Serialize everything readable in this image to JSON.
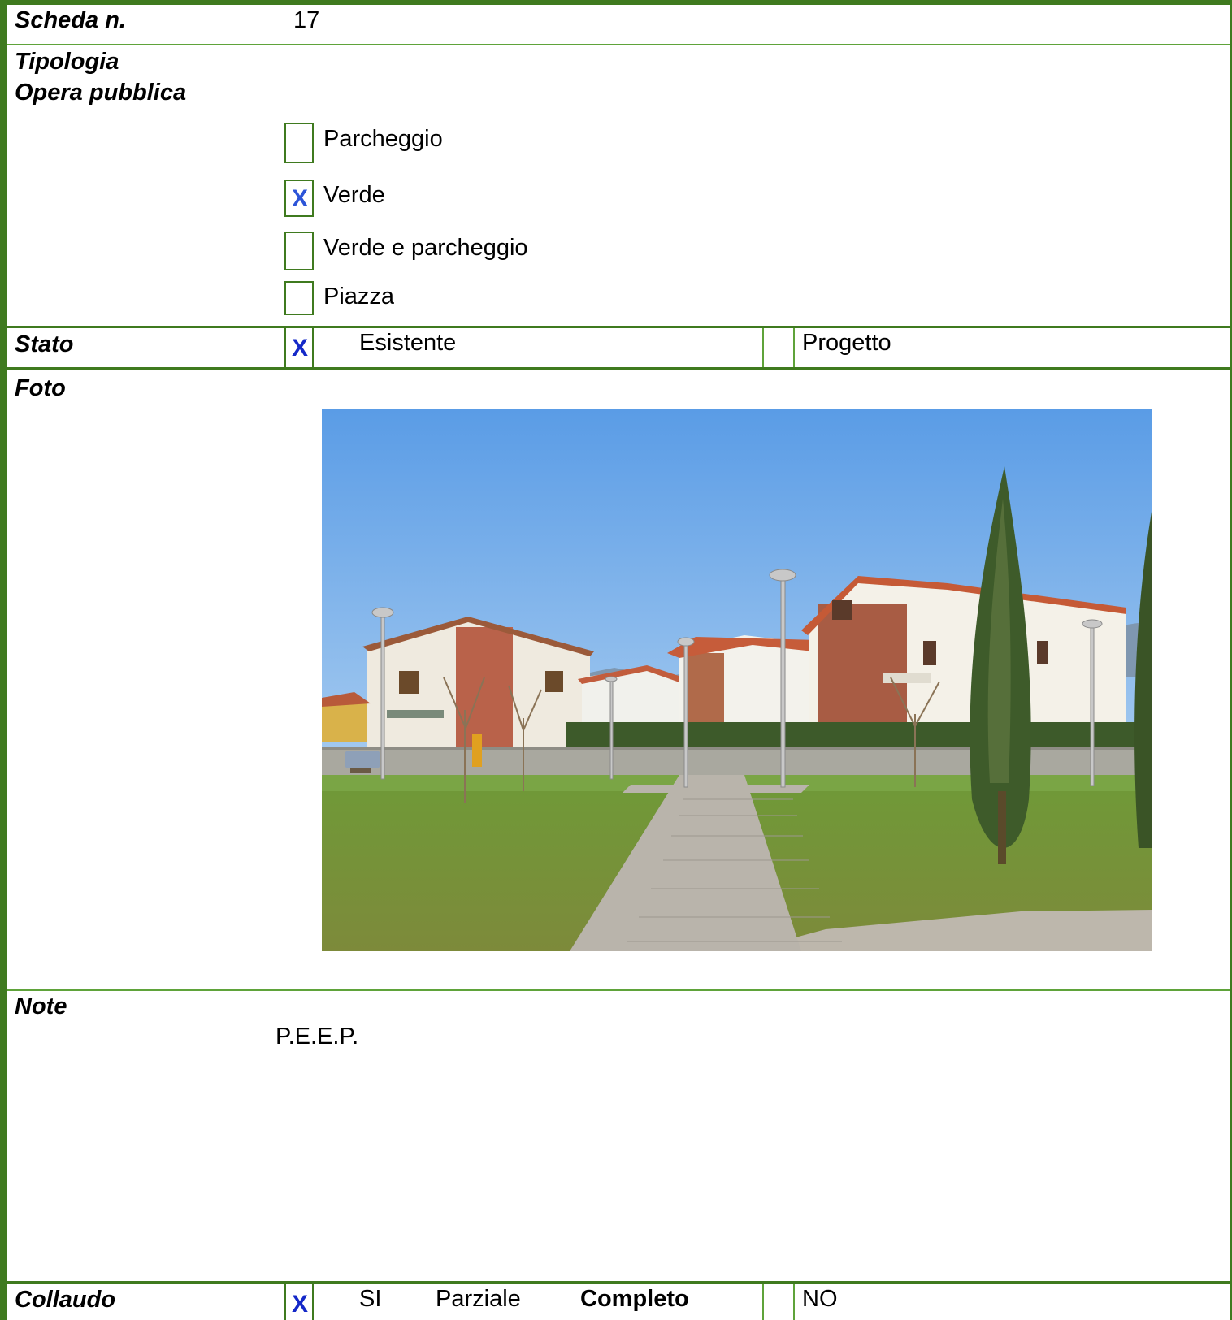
{
  "header": {
    "label": "Scheda n.",
    "number": "17"
  },
  "tipologia": {
    "label_line1": "Tipologia",
    "label_line2": "Opera pubblica",
    "options": [
      {
        "label": "Parcheggio",
        "checked": false
      },
      {
        "label": "Verde",
        "checked": true,
        "mark": "X"
      },
      {
        "label": "Verde e parcheggio",
        "checked": false
      },
      {
        "label": "Piazza",
        "checked": false
      }
    ]
  },
  "stato": {
    "label": "Stato",
    "esistente_mark": "X",
    "esistente_label": "Esistente",
    "progetto_label": "Progetto"
  },
  "foto": {
    "label": "Foto"
  },
  "note": {
    "label": "Note",
    "text": "P.E.E.P."
  },
  "collaudo": {
    "label": "Collaudo",
    "si_mark": "X",
    "si_label": "SI",
    "parziale_label": "Parziale",
    "completo_label": "Completo",
    "no_label": "NO"
  },
  "colors": {
    "border": "#3f7a1f",
    "check_mark": "#2c54d8",
    "sky": "#6aa8e8",
    "grass": "#6f9a38"
  }
}
